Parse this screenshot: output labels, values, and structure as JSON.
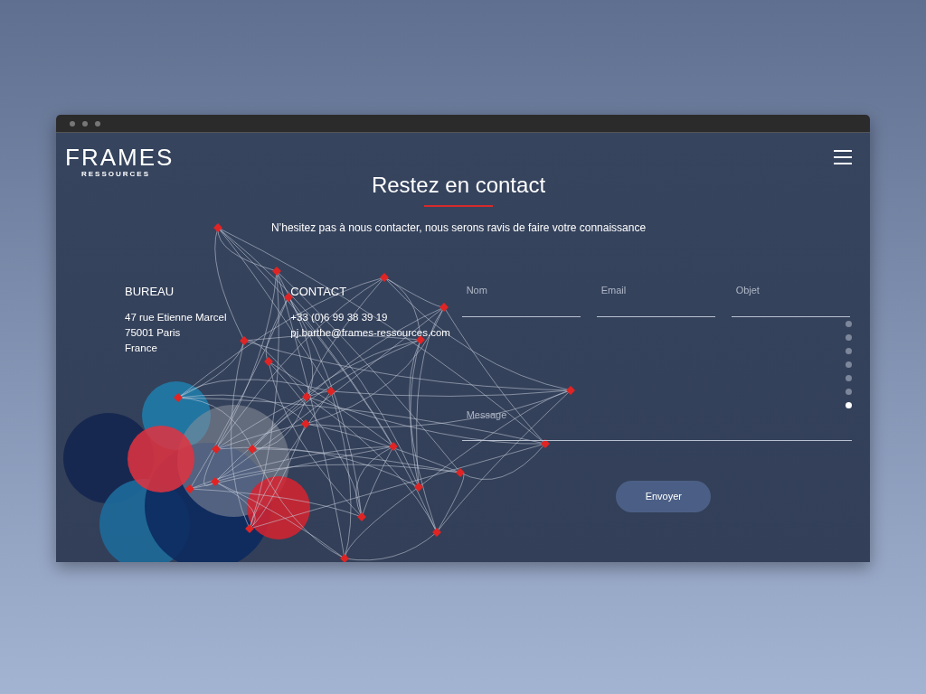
{
  "logo": {
    "name": "FRAMES",
    "subtitle": "RESSOURCES"
  },
  "title": "Restez en contact",
  "subtitle": "N’hesitez pas à nous contacter, nous serons ravis de faire votre connaissance",
  "bureau": {
    "heading": "BUREAU",
    "lines": [
      "47 rue Etienne Marcel",
      "75001 Paris",
      "France"
    ]
  },
  "contact": {
    "heading": "CONTACT",
    "lines": [
      "+33 (0)6 99 38 39 19",
      "pj.barthe@frames-ressources.com"
    ]
  },
  "form": {
    "fields": [
      {
        "placeholder": "Nom"
      },
      {
        "placeholder": "Email"
      },
      {
        "placeholder": "Objet"
      }
    ],
    "message": {
      "placeholder": "Message"
    },
    "submit": "Envoyer"
  },
  "page_dots": [
    {
      "selected": false
    },
    {
      "selected": false
    },
    {
      "selected": false
    },
    {
      "selected": false
    },
    {
      "selected": false
    },
    {
      "selected": false
    },
    {
      "selected": true
    }
  ]
}
